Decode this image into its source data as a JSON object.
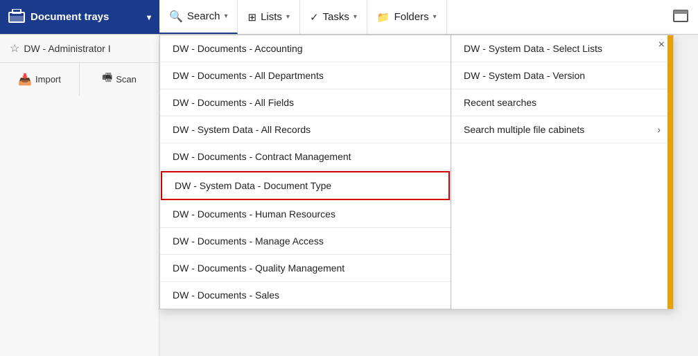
{
  "topNav": {
    "leftPanel": {
      "label": "Document trays",
      "icon": "inbox-icon",
      "chevron": "▾"
    },
    "items": [
      {
        "id": "search",
        "icon": "🔍",
        "label": "Search",
        "chevron": "▾",
        "active": true
      },
      {
        "id": "lists",
        "icon": "⊞",
        "label": "Lists",
        "chevron": "▾"
      },
      {
        "id": "tasks",
        "icon": "✓",
        "label": "Tasks",
        "chevron": "▾"
      },
      {
        "id": "folders",
        "icon": "📁",
        "label": "Folders",
        "chevron": "▾"
      }
    ]
  },
  "sidebar": {
    "title": "DW - Administrator I",
    "star_icon": "☆",
    "actions": [
      {
        "id": "import",
        "icon": "📥",
        "label": "Import"
      },
      {
        "id": "scan",
        "icon": "🖷",
        "label": "Scan"
      }
    ]
  },
  "dropdown": {
    "leftColumn": [
      {
        "id": "accounting",
        "label": "DW - Documents - Accounting",
        "highlighted": false
      },
      {
        "id": "all-departments",
        "label": "DW - Documents - All Departments",
        "highlighted": false
      },
      {
        "id": "all-fields",
        "label": "DW - Documents - All Fields",
        "highlighted": false
      },
      {
        "id": "system-all-records",
        "label": "DW - System Data - All Records",
        "highlighted": false
      },
      {
        "id": "contract-mgmt",
        "label": "DW - Documents - Contract Management",
        "highlighted": false
      },
      {
        "id": "system-doc-type",
        "label": "DW - System Data - Document Type",
        "highlighted": true
      },
      {
        "id": "human-resources",
        "label": "DW - Documents - Human Resources",
        "highlighted": false
      },
      {
        "id": "manage-access",
        "label": "DW - Documents - Manage Access",
        "highlighted": false
      },
      {
        "id": "quality-mgmt",
        "label": "DW - Documents - Quality Management",
        "highlighted": false
      },
      {
        "id": "sales",
        "label": "DW - Documents - Sales",
        "highlighted": false
      }
    ],
    "rightColumn": [
      {
        "id": "select-lists",
        "label": "DW - System Data - Select Lists",
        "hasArrow": false
      },
      {
        "id": "version",
        "label": "DW - System Data - Version",
        "hasArrow": false
      },
      {
        "id": "recent-searches",
        "label": "Recent searches",
        "hasArrow": false
      },
      {
        "id": "multiple-cabinets",
        "label": "Search multiple file cabinets",
        "hasArrow": true
      }
    ],
    "closeLabel": "×"
  }
}
